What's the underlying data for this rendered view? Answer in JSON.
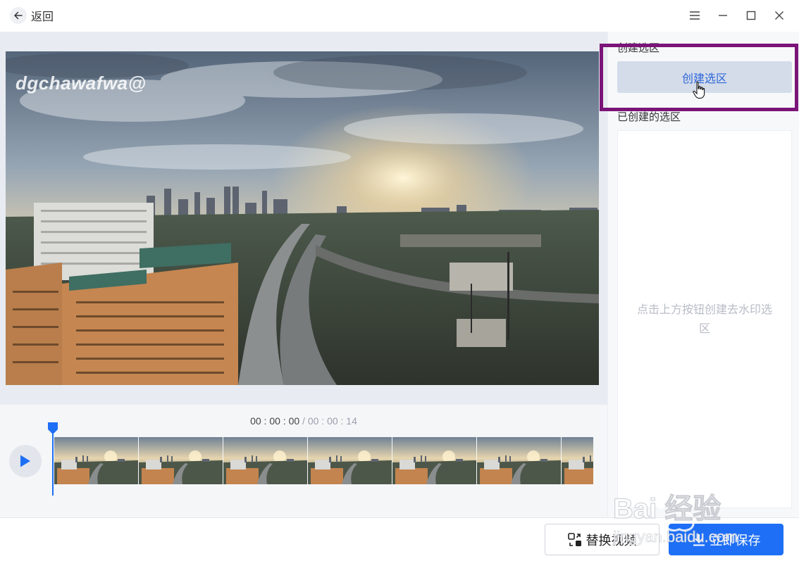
{
  "titlebar": {
    "back_label": "返回",
    "icons": [
      "back-arrow-icon",
      "menu-icon",
      "minimize-icon",
      "maximize-icon",
      "close-icon"
    ]
  },
  "preview": {
    "watermark_text": "dgchawafwa@"
  },
  "timeline": {
    "current_time": "00 : 00 : 00",
    "separator": " / ",
    "duration": "00 : 00 : 14",
    "frame_count": 7
  },
  "sidebar": {
    "create_section_label": "创建选区",
    "create_button_label": "创建选区",
    "created_section_label": "已创建的选区",
    "empty_hint": "点击上方按钮创建去水印选区"
  },
  "footer": {
    "replace_label": "替换视频",
    "save_label": "立即保存"
  },
  "overlay": {
    "brand_logo": "Baidu经验",
    "brand_url": "jingyan.baidu.com"
  },
  "colors": {
    "accent": "#1e6ff5",
    "highlight_frame": "#7a1478",
    "create_button_bg": "#d4dcea",
    "create_button_text": "#2f67d8"
  }
}
